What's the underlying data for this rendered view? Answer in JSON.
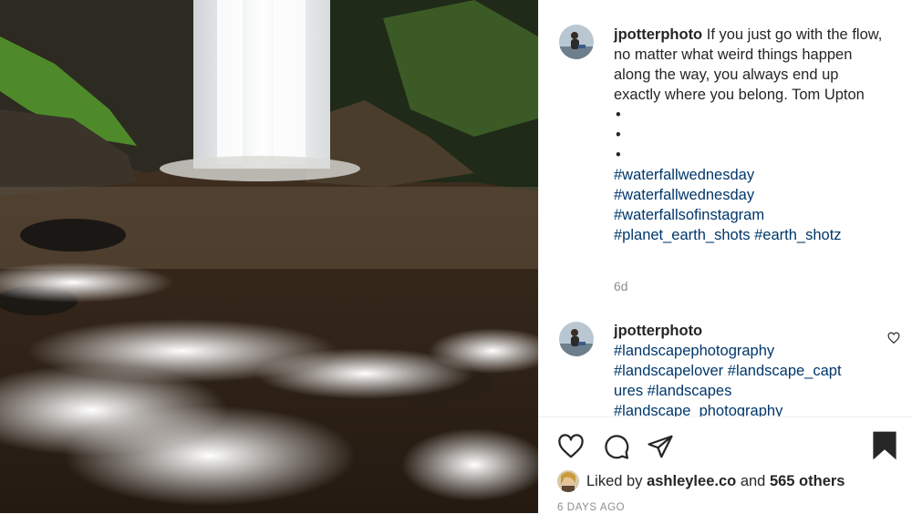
{
  "post": {
    "image_alt": "Waterfall and rushing river photograph"
  },
  "comments": [
    {
      "username": "jpotterphoto",
      "text": "If you just go with the flow, no matter what weird things happen along the way, you always end up exactly where you belong. Tom Upton",
      "bullets": [
        "•",
        "•",
        "•"
      ],
      "hashtags": [
        "#waterfallwednesday",
        "#waterfallwednesday",
        "#waterfallsofinstagram"
      ],
      "hashtag_line": [
        "#planet_earth_shots",
        "#earth_shotz"
      ],
      "time": "6d"
    },
    {
      "username": "jpotterphoto",
      "hashtags": [
        "#landscapephotography"
      ],
      "hashtag_line": [
        "#landscapelover",
        "#landscape_capt"
      ],
      "hashtags2": [
        "ures #landscapes",
        "#landscape_photography"
      ]
    }
  ],
  "actions": {
    "icons": [
      "heart-icon",
      "comment-icon",
      "share-icon",
      "bookmark-icon"
    ]
  },
  "likes": {
    "prefix": "Liked by",
    "user": "ashleylee.co",
    "joiner": "and",
    "others": "565 others"
  },
  "date": "6 DAYS AGO",
  "colors": {
    "link": "#00376b",
    "muted": "#8e8e8e",
    "text": "#262626"
  }
}
